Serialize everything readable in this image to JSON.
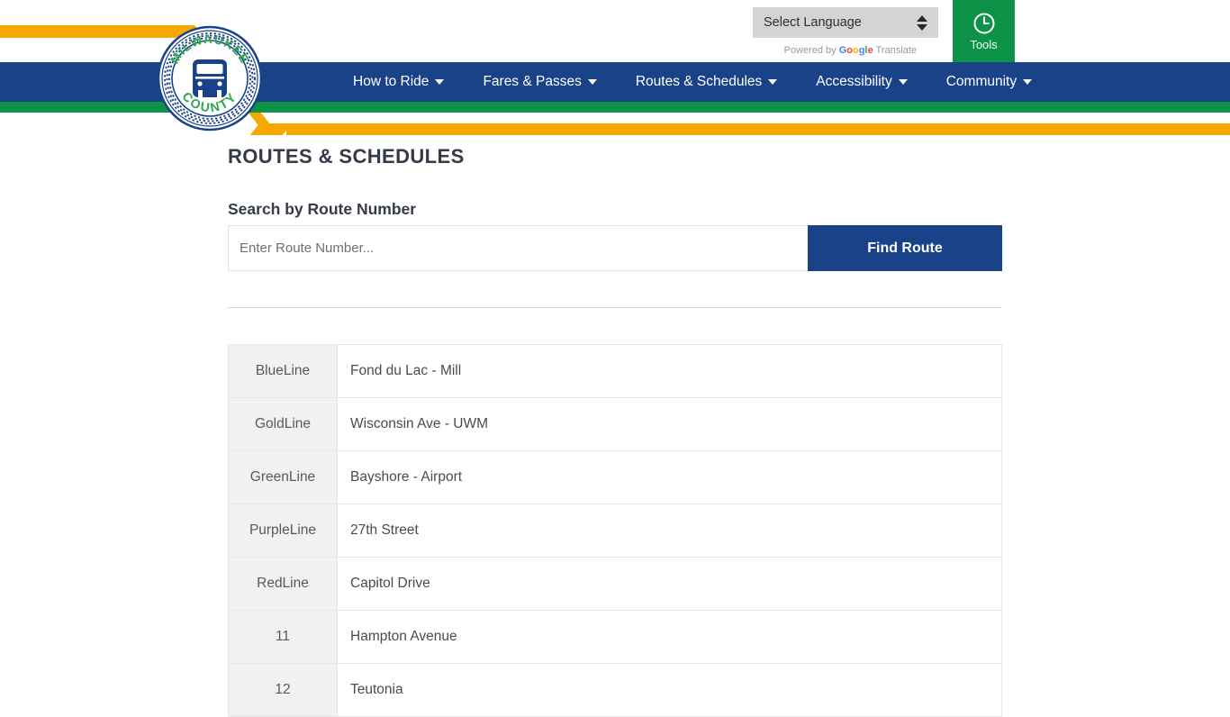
{
  "header": {
    "logo": {
      "top_text": "MILWAUKEE",
      "bottom_text": "COUNTY",
      "icon": "bus-icon"
    },
    "language": {
      "label": "Select Language",
      "powered_by": "Powered by",
      "google_word": "Google",
      "translate_word": "Translate"
    },
    "tools": {
      "label": "Tools",
      "icon": "clock-icon"
    },
    "nav": [
      {
        "label": "How to Ride"
      },
      {
        "label": "Fares & Passes"
      },
      {
        "label": "Routes & Schedules"
      },
      {
        "label": "Accessibility"
      },
      {
        "label": "Community"
      }
    ],
    "colors": {
      "orange": "#f5a800",
      "blue": "#1a4289",
      "green": "#0c9347"
    }
  },
  "main": {
    "page_title": "ROUTES & SCHEDULES",
    "search_heading": "Search by Route Number",
    "search_placeholder": "Enter Route Number...",
    "search_value": "",
    "find_button": "Find Route",
    "routes": [
      {
        "id": "BlueLine",
        "name": "Fond du Lac - Mill"
      },
      {
        "id": "GoldLine",
        "name": "Wisconsin Ave - UWM"
      },
      {
        "id": "GreenLine",
        "name": "Bayshore - Airport"
      },
      {
        "id": "PurpleLine",
        "name": "27th Street"
      },
      {
        "id": "RedLine",
        "name": "Capitol Drive"
      },
      {
        "id": "11",
        "name": "Hampton Avenue"
      },
      {
        "id": "12",
        "name": "Teutonia"
      }
    ]
  }
}
